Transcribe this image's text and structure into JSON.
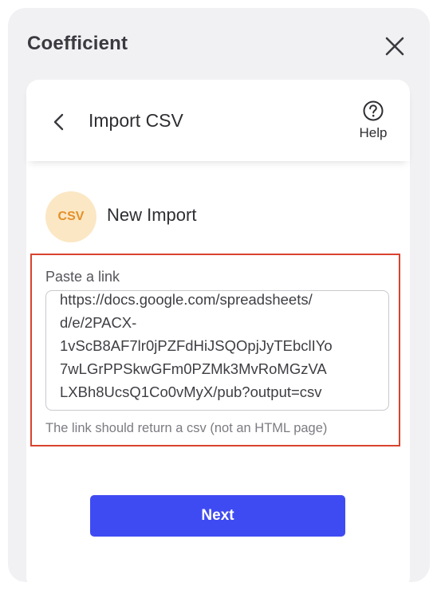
{
  "app": {
    "title": "Coefficient",
    "close_icon": "close-icon"
  },
  "card": {
    "back_icon": "chevron-left-icon",
    "title": "Import CSV",
    "help_icon": "question-circle-icon",
    "help_label": "Help"
  },
  "import": {
    "badge": "CSV",
    "title": "New Import"
  },
  "link_field": {
    "label": "Paste a link",
    "value": "https://docs.google.com/spreadsheets/\nd/e/2PACX-\n1vScB8AF7lr0jPZFdHiJSQOpjJyTEbclIYo\n7wLGrPPSkwGFm0PZMk3MvRoMGzVA\nLXBh8UcsQ1Co0vMyX/pub?output=csv",
    "hint": "The link should return a csv (not an HTML page)"
  },
  "actions": {
    "next_label": "Next"
  },
  "colors": {
    "accent": "#3f4bf2",
    "highlight": "#d9432f",
    "badge_bg": "#fbe7c4",
    "badge_text": "#e5902a",
    "panel_bg": "#f1f1f4"
  }
}
